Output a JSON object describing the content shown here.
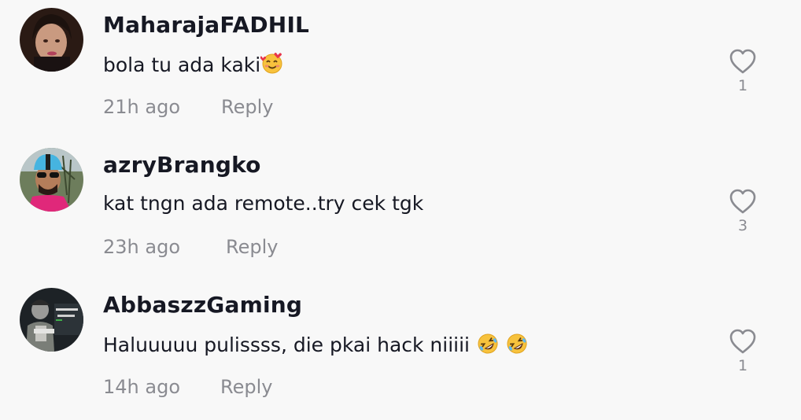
{
  "comments": [
    {
      "username": "MaharajaFADHIL",
      "text": "bola tu ada kaki",
      "emojis": [
        "smiling-face-with-hearts"
      ],
      "time": "21h ago",
      "reply_label": "Reply",
      "likes": "1",
      "like_icon": "heart-outline-icon"
    },
    {
      "username": "azryBrangko",
      "text": "kat tngn ada remote..try cek tgk",
      "emojis": [],
      "time": "23h ago",
      "reply_label": "Reply",
      "likes": "3",
      "like_icon": "heart-outline-icon"
    },
    {
      "username": "AbbaszzGaming",
      "text": "Haluuuuu pulissss, die pkai hack niiiii ",
      "emojis": [
        "rolling-on-floor-laughing",
        "rolling-on-floor-laughing"
      ],
      "time": "14h ago",
      "reply_label": "Reply",
      "likes": "1",
      "like_icon": "heart-outline-icon"
    }
  ],
  "colors": {
    "background": "#f8f8f8",
    "primary_text": "#161823",
    "secondary_text": "#8a8b91"
  }
}
